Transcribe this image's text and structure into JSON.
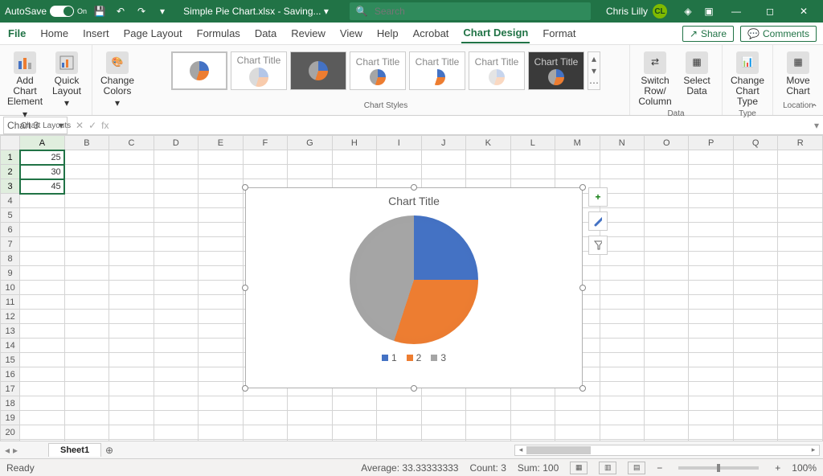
{
  "titlebar": {
    "autosave_label": "AutoSave",
    "autosave_state": "On",
    "doc_name": "Simple Pie Chart.xlsx",
    "doc_status": "Saving...",
    "search_placeholder": "Search",
    "user_name": "Chris Lilly",
    "user_initials": "CL"
  },
  "tabs": {
    "items": [
      "File",
      "Home",
      "Insert",
      "Page Layout",
      "Formulas",
      "Data",
      "Review",
      "View",
      "Help",
      "Acrobat",
      "Chart Design",
      "Format"
    ],
    "active": "Chart Design",
    "share": "Share",
    "comments": "Comments"
  },
  "ribbon": {
    "layouts_group": "Chart Layouts",
    "add_element": "Add Chart Element",
    "quick_layout": "Quick Layout",
    "change_colors": "Change Colors",
    "styles_group": "Chart Styles",
    "style_caption": "Chart Title",
    "data_group": "Data",
    "switch": "Switch Row/ Column",
    "select_data": "Select Data",
    "type_group": "Type",
    "change_type": "Change Chart Type",
    "location_group": "Location",
    "move_chart": "Move Chart"
  },
  "fbar": {
    "namebox": "Chart 3",
    "fx": "fx"
  },
  "grid": {
    "cols": [
      "A",
      "B",
      "C",
      "D",
      "E",
      "F",
      "G",
      "H",
      "I",
      "J",
      "K",
      "L",
      "M",
      "N",
      "O",
      "P",
      "Q",
      "R"
    ],
    "rows": 22,
    "values": {
      "A1": "25",
      "A2": "30",
      "A3": "45"
    }
  },
  "chart_side": {
    "plus": "+",
    "brush": "🖌",
    "funnel": "⏷"
  },
  "chart_data": {
    "type": "pie",
    "title": "Chart Title",
    "categories": [
      "1",
      "2",
      "3"
    ],
    "values": [
      25,
      30,
      45
    ],
    "colors": [
      "#4472C4",
      "#ED7D31",
      "#A5A5A5"
    ],
    "legend_position": "bottom"
  },
  "sheettabs": {
    "active": "Sheet1"
  },
  "status": {
    "ready": "Ready",
    "average_label": "Average:",
    "average": "33.33333333",
    "count_label": "Count:",
    "count": "3",
    "sum_label": "Sum:",
    "sum": "100",
    "zoom": "100%"
  }
}
